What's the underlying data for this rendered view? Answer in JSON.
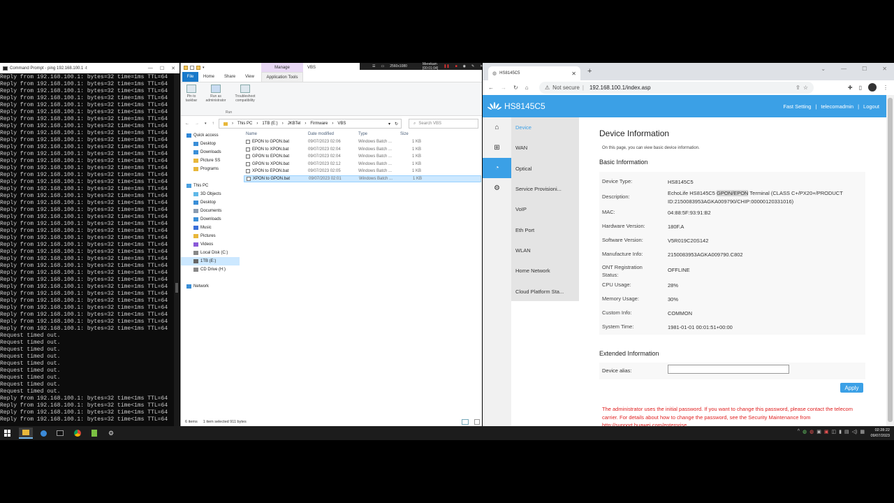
{
  "cmd": {
    "title": "Command Prompt - ping 192.168.100.1 -t",
    "lines": [
      "Reply from 192.168.100.1: bytes=32 time=1ms TTL=64",
      "Reply from 192.168.100.1: bytes=32 time=1ms TTL=64",
      "Reply from 192.168.100.1: bytes=32 time<1ms TTL=64",
      "Reply from 192.168.100.1: bytes=32 time=1ms TTL=64",
      "Reply from 192.168.100.1: bytes=32 time<1ms TTL=64",
      "Reply from 192.168.100.1: bytes=32 time<1ms TTL=64",
      "Reply from 192.168.100.1: bytes=32 time=1ms TTL=64",
      "Reply from 192.168.100.1: bytes=32 time<1ms TTL=64",
      "Reply from 192.168.100.1: bytes=32 time=1ms TTL=64",
      "Reply from 192.168.100.1: bytes=32 time=1ms TTL=64",
      "Reply from 192.168.100.1: bytes=32 time<1ms TTL=64",
      "Reply from 192.168.100.1: bytes=32 time<1ms TTL=64",
      "Reply from 192.168.100.1: bytes=32 time<1ms TTL=64",
      "Reply from 192.168.100.1: bytes=32 time=1ms TTL=64",
      "Reply from 192.168.100.1: bytes=32 time=1ms TTL=64",
      "Reply from 192.168.100.1: bytes=32 time<1ms TTL=64",
      "Reply from 192.168.100.1: bytes=32 time=1ms TTL=64",
      "Reply from 192.168.100.1: bytes=32 time=1ms TTL=64",
      "Reply from 192.168.100.1: bytes=32 time<1ms TTL=64",
      "Reply from 192.168.100.1: bytes=32 time=1ms TTL=64",
      "Reply from 192.168.100.1: bytes=32 time<1ms TTL=64",
      "Reply from 192.168.100.1: bytes=32 time<1ms TTL=64",
      "Reply from 192.168.100.1: bytes=32 time=1ms TTL=64",
      "Reply from 192.168.100.1: bytes=32 time<1ms TTL=64",
      "Reply from 192.168.100.1: bytes=32 time<1ms TTL=64",
      "Reply from 192.168.100.1: bytes=32 time<1ms TTL=64",
      "Reply from 192.168.100.1: bytes=32 time=1ms TTL=64",
      "Reply from 192.168.100.1: bytes=32 time<1ms TTL=64",
      "Reply from 192.168.100.1: bytes=32 time=1ms TTL=64",
      "Reply from 192.168.100.1: bytes=32 time<1ms TTL=64",
      "Reply from 192.168.100.1: bytes=32 time=1ms TTL=64",
      "Reply from 192.168.100.1: bytes=32 time<1ms TTL=64",
      "Reply from 192.168.100.1: bytes=32 time<1ms TTL=64",
      "Reply from 192.168.100.1: bytes=32 time=1ms TTL=64",
      "Reply from 192.168.100.1: bytes=32 time<1ms TTL=64",
      "Reply from 192.168.100.1: bytes=32 time=1ms TTL=64",
      "Reply from 192.168.100.1: bytes=32 time<1ms TTL=64",
      "Request timed out.",
      "Request timed out.",
      "Request timed out.",
      "Request timed out.",
      "Request timed out.",
      "Request timed out.",
      "Request timed out.",
      "Request timed out.",
      "Request timed out.",
      "Reply from 192.168.100.1: bytes=32 time<1ms TTL=64",
      "Reply from 192.168.100.1: bytes=32 time<1ms TTL=64",
      "Reply from 192.168.100.1: bytes=32 time<1ms TTL=64",
      "Reply from 192.168.100.1: bytes=32 time<1ms TTL=64"
    ]
  },
  "explorer": {
    "manage_tab": "Manage",
    "window_title": "VBS",
    "tabs": [
      "File",
      "Home",
      "Share",
      "View"
    ],
    "app_tools": "Application Tools",
    "ribbon": {
      "pin_label": "Pin to taskbar",
      "run_admin_label": "Run as administrator",
      "troubleshoot_label": "Troubleshoot compatibility",
      "group": "Run"
    },
    "breadcrumb": [
      "This PC",
      "1TB (E:)",
      "JKBTel",
      "Firmware",
      "VBS"
    ],
    "search_placeholder": "Search VBS",
    "nav": [
      {
        "label": "Quick access",
        "indent": 0,
        "color": "#2f87d8"
      },
      {
        "label": "Desktop",
        "indent": 1,
        "color": "#3a8fd8"
      },
      {
        "label": "Downloads",
        "indent": 1,
        "color": "#3a8fd8"
      },
      {
        "label": "Picture SS",
        "indent": 1,
        "color": "#e8b73a"
      },
      {
        "label": "Programs",
        "indent": 1,
        "color": "#e8b73a"
      },
      {
        "label": "",
        "indent": 0,
        "color": ""
      },
      {
        "label": "This PC",
        "indent": 0,
        "color": "#4aa0e0"
      },
      {
        "label": "3D Objects",
        "indent": 1,
        "color": "#5fb8e8"
      },
      {
        "label": "Desktop",
        "indent": 1,
        "color": "#3a8fd8"
      },
      {
        "label": "Documents",
        "indent": 1,
        "color": "#8a9bb0"
      },
      {
        "label": "Downloads",
        "indent": 1,
        "color": "#3a8fd8"
      },
      {
        "label": "Music",
        "indent": 1,
        "color": "#3a6fd8"
      },
      {
        "label": "Pictures",
        "indent": 1,
        "color": "#e8b73a"
      },
      {
        "label": "Videos",
        "indent": 1,
        "color": "#8a5ad8"
      },
      {
        "label": "Local Disk (C:)",
        "indent": 1,
        "color": "#888888"
      },
      {
        "label": "1TB (E:)",
        "indent": 1,
        "color": "#666666",
        "selected": true
      },
      {
        "label": "CD Drive (H:)",
        "indent": 1,
        "color": "#888888"
      },
      {
        "label": "",
        "indent": 0,
        "color": ""
      },
      {
        "label": "Network",
        "indent": 0,
        "color": "#3a8fd8"
      }
    ],
    "columns": [
      "Name",
      "Date modified",
      "Type",
      "Size"
    ],
    "files": [
      {
        "name": "EPON to GPON.bat",
        "date": "09/07/2023 02:06",
        "type": "Windows Batch ...",
        "size": "1 KB"
      },
      {
        "name": "EPON to XPON.bat",
        "date": "09/07/2023 02:04",
        "type": "Windows Batch ...",
        "size": "1 KB"
      },
      {
        "name": "GPON to EPON.bat",
        "date": "09/07/2023 02:04",
        "type": "Windows Batch ...",
        "size": "1 KB"
      },
      {
        "name": "GPON to XPON.bat",
        "date": "09/07/2023 02:12",
        "type": "Windows Batch ...",
        "size": "1 KB"
      },
      {
        "name": "XPON to EPON.bat",
        "date": "09/07/2023 02:05",
        "type": "Windows Batch ...",
        "size": "1 KB"
      },
      {
        "name": "XPON to GPON.bat",
        "date": "09/07/2023 02:01",
        "type": "Windows Batch ...",
        "size": "1 KB",
        "selected": true
      }
    ],
    "status": {
      "items": "6 items",
      "selected": "1 item selected  911 bytes"
    }
  },
  "recorder": {
    "resolution": "2560x1080",
    "label": "Merekam [00:01:04]"
  },
  "chrome": {
    "tab_title": "HS8145C5",
    "not_secure": "Not secure",
    "url": "192.168.100.1/index.asp"
  },
  "router": {
    "brand": "HS8145C5",
    "nav": {
      "fast_setting": "Fast Setting",
      "sep": "|",
      "user": "telecomadmin",
      "logout": "Logout"
    },
    "menu": [
      "Device",
      "WAN",
      "Optical",
      "Service Provisioni...",
      "VoIP",
      "Eth Port",
      "WLAN",
      "Home Network",
      "Cloud Platform Sta..."
    ],
    "page_title": "Device Information",
    "intro": "On this page, you can view basic device information.",
    "basic_title": "Basic Information",
    "info": {
      "type_k": "Device Type:",
      "type_v": "HS8145C5",
      "desc_k": "Description:",
      "desc_v1": "EchoLife HS8145C5 ",
      "desc_hl": "GPON/EPON",
      "desc_v2": " Terminal (CLASS C+/PX20+/PRODUCT ID:2150083953AGKA009790/CHIP:00000120331016)",
      "mac_k": "MAC:",
      "mac_v": "04:88:5F:93:91:B2",
      "hw_k": "Hardware Version:",
      "hw_v": "180F.A",
      "sw_k": "Software Version:",
      "sw_v": "V5R019C20S142",
      "mf_k": "Manufacture Info:",
      "mf_v": "2150083953AGKA009790.C802",
      "ont_k": "ONT Registration Status:",
      "ont_v": "OFFLINE",
      "cpu_k": "CPU Usage:",
      "cpu_v": "28%",
      "mem_k": "Memory Usage:",
      "mem_v": "30%",
      "ci_k": "Custom Info:",
      "ci_v": "COMMON",
      "st_k": "System Time:",
      "st_v": "1981-01-01 00:01:51+00:00"
    },
    "extended_title": "Extended Information",
    "alias_label": "Device alias:",
    "alias_value": "",
    "apply": "Apply",
    "warning": "The administrator uses the initial password. If you want to change this password, please contact the telecom carrier. For details about how to change the password, see the Security Maintenance from http://support.huawei.com/enterprise."
  },
  "taskbar": {
    "time": "02:28:22",
    "date": "09/07/2023"
  },
  "colors": {
    "huawei_blue": "#3ba0e6",
    "warning_red": "#e02020",
    "selection": "#cce8ff"
  }
}
